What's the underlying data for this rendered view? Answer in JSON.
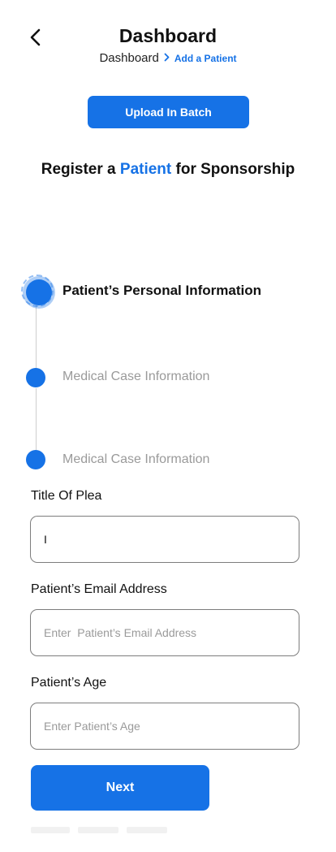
{
  "header": {
    "title": "Dashboard",
    "back_icon": "chevron-left-icon",
    "breadcrumb": {
      "home": "Dashboard",
      "separator": "›",
      "current": "Add a Patient"
    }
  },
  "upload": {
    "label": "Upload In Batch"
  },
  "heading": {
    "prefix": "Register a ",
    "accent": "Patient",
    "suffix": " for Sponsorship"
  },
  "steps": [
    {
      "label": "Patient’s Personal Information",
      "active": true
    },
    {
      "label": "Medical Case Information",
      "active": false
    },
    {
      "label": "Medical Case Information",
      "active": false
    }
  ],
  "form": {
    "title_of_plea": {
      "label": "Title Of Plea",
      "value": "I",
      "placeholder": ""
    },
    "email": {
      "label": "Patient’s Email Address",
      "value": "",
      "placeholder": "Enter  Patient’s Email Address"
    },
    "age": {
      "label": "Patient’s Age",
      "value": "",
      "placeholder": "Enter Patient’s Age"
    }
  },
  "next": {
    "label": "Next"
  },
  "colors": {
    "accent": "#1672e6",
    "muted_text": "#9a9a9a",
    "border": "#7d7d7d"
  }
}
